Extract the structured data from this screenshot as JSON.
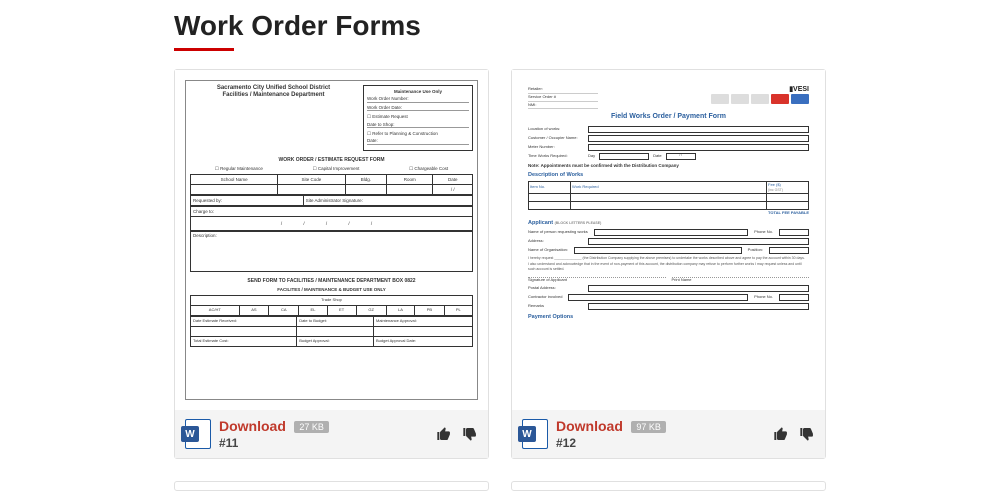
{
  "page": {
    "title": "Work Order Forms"
  },
  "cards": [
    {
      "download_label": "Download",
      "size": "27 KB",
      "number": "#11",
      "doc": {
        "org": "Sacramento City Unified School District",
        "dept": "Facilities / Maintenance Department",
        "box_title": "Maintenance Use Only",
        "box_r1": "Work Order Number:",
        "box_r2": "Work Order Date:",
        "box_r3": "☐ Estimate Request",
        "box_r3b": "Date to Shop:",
        "box_r4": "☐ Refer to Planning & Construction",
        "box_r4b": "Date:",
        "form_title": "WORK ORDER / ESTIMATE REQUEST FORM",
        "check1": "Regular Maintenance",
        "check2": "Capital Improvement",
        "check3": "Chargeable Cost",
        "th1": "School Name",
        "th2": "Site Code",
        "th3": "Bldg.",
        "th4": "Room",
        "th5": "Date",
        "date_ph": "/     /",
        "req_by": "Requested by:",
        "admin_sig": "Site Administrator Signature:",
        "charge_to": "Charge to:",
        "desc": "Description:",
        "send": "SEND FORM TO FACILITIES / MAINTENANCE DEPARTMENT BOX 0822",
        "fac_use": "FACILITES / MAINTENANCE & BUDGET USE ONLY",
        "trade": "Trade Shop",
        "codes": [
          "AC/HT",
          "AS",
          "CA",
          "EL",
          "ET",
          "GZ",
          "LA",
          "PB",
          "PL"
        ],
        "est_recv": "Date Estimate Received:",
        "to_budget": "Date to Budget:",
        "maint_appr": "Maintenance Approval:",
        "total_est": "Total Estimate Cost:",
        "budget_appr": "Budget Approval:",
        "budget_appr_date": "Budget Approval Date:"
      }
    },
    {
      "download_label": "Download",
      "size": "97 KB",
      "number": "#12",
      "doc": {
        "retailer": "Retailer:",
        "service_order": "Service Order #",
        "nmi": "NMI:",
        "vesi": "▮VESI",
        "title": "Field Works Order / Payment Form",
        "loc": "Location of works:",
        "cust": "Customer / Occupier Name:",
        "meter": "Meter Number:",
        "time": "Time Works Required:",
        "day": "Day",
        "date": "Date",
        "date_val": "/     /",
        "note": "Note:    Appointments must be confirmed with the Distribution Company",
        "sec_desc": "Description of Works",
        "th_item": "Item No.",
        "th_work": "Work Required",
        "th_fee": "Fee ($)",
        "fee_note": "(inc GST)",
        "total_fee": "TOTAL FEE PAYABLE",
        "sec_app": "Applicant",
        "app_note": "(BLOCK LETTERS PLEASE)",
        "app_name": "Name of person requesting works",
        "phone": "Phone No.",
        "addr": "Address:",
        "org": "Name of Organisation:",
        "pos": "Position:",
        "req_text1": "I hereby request",
        "req_text1b": "(the Distribution Company supplying the above premises) to undertake",
        "req_text2": "the works described above and agree to pay the account within 30 days.",
        "req_text3": "I also understand and acknowledge that in the event of non-payment of this account, the distribution company may refuse to perform further works I may request unless and until such account is settled.",
        "sig": "Signature of Applicant",
        "print": "Print Name",
        "postal": "Postal Address:",
        "contractor": "Contractor involved",
        "remarks": "Remarks",
        "sec_pay": "Payment Options"
      }
    }
  ]
}
